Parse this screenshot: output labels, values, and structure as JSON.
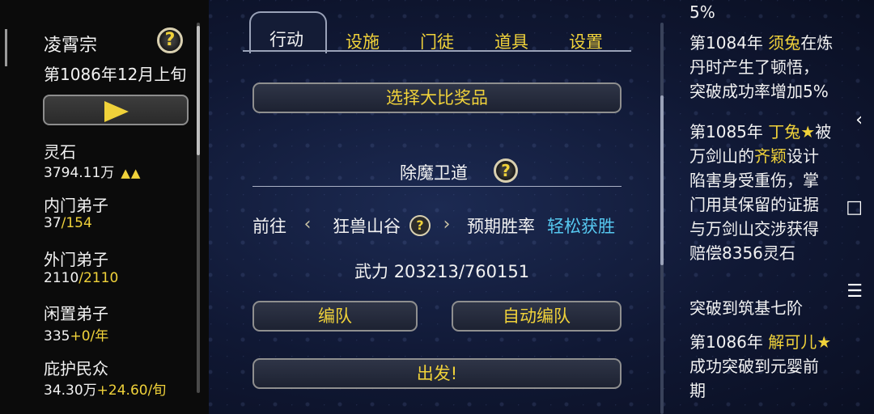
{
  "sect": {
    "name": "凌霄宗",
    "date": "第1086年12月上旬"
  },
  "resources": [
    {
      "label": "灵石",
      "value": "3794.11万",
      "extra": "▲▲"
    },
    {
      "label": "内门弟子",
      "value": "37",
      "extra": "/154"
    },
    {
      "label": "外门弟子",
      "value": "2110",
      "extra": "/2110"
    },
    {
      "label": "闲置弟子",
      "value": "335",
      "extra": "+0/年"
    },
    {
      "label": "庇护民众",
      "value": "34.30万",
      "extra": "+24.60/旬"
    }
  ],
  "tabs": [
    "行动",
    "设施",
    "门徒",
    "道具",
    "设置"
  ],
  "buttons": {
    "select_prize": "选择大比奖品",
    "formation": "编队",
    "auto_formation": "自动编队",
    "depart": "出发!"
  },
  "mission": {
    "title": "除魔卫道",
    "goto_label": "前往",
    "location": "狂兽山谷",
    "rate_label": "预期胜率",
    "rate_value": "轻松获胜",
    "power_label": "武力",
    "power_value": "203213/760151"
  },
  "log": {
    "top_fragment": "5%",
    "entry1": {
      "year": "第1084年",
      "name": "须兔",
      "text1": "在炼",
      "line2": "丹时产生了顿悟，",
      "line3": "突破成功率增加5%"
    },
    "entry2": {
      "year": "第1085年",
      "name": "丁兔★",
      "text1": "被",
      "line2": "万剑山的",
      "name2": "齐颖",
      "text2": "设计",
      "line3": "陷害身受重伤，掌",
      "line4": "门用其保留的证据",
      "line5": "与万剑山交涉获得",
      "line6": "赔偿8356灵石"
    },
    "entry2b": "突破到筑基七阶",
    "entry3": {
      "year": "第1086年",
      "name": "解可儿★",
      "line2": "成功突破到元婴前",
      "line3": "期"
    }
  },
  "icons": {
    "help": "?",
    "back": "‹",
    "square": "□",
    "menu": "☰"
  },
  "colors": {
    "gold": "#f0d23a",
    "cyan": "#56c8f0",
    "text": "#f2f2f2"
  }
}
